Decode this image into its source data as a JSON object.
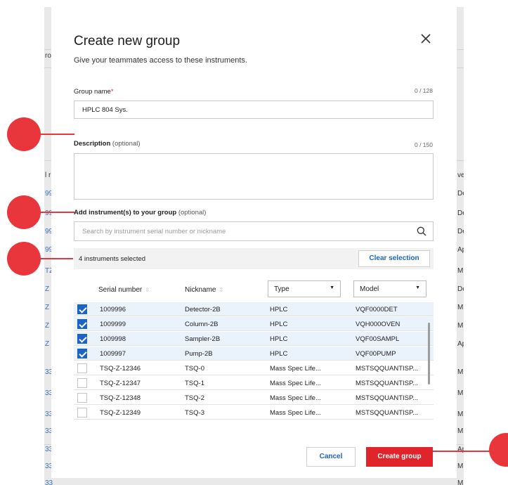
{
  "background": {
    "left_fragments": [
      "ro",
      "l r",
      "99",
      "99",
      "99",
      "99",
      "TZ",
      "Z",
      "Z",
      "Z",
      "Z",
      "33",
      "33",
      "33",
      "33",
      "33",
      "33",
      "33"
    ],
    "right_fragments": [
      "ve",
      "De",
      "De",
      "De",
      "Ap",
      "M",
      "De",
      "M",
      "M",
      "Ap",
      "M",
      "M",
      "M",
      "M",
      "Ap",
      "M",
      "M"
    ]
  },
  "modal": {
    "title": "Create new group",
    "subtitle": "Give your teammates access to these instruments.",
    "close_icon": "close-icon",
    "group_name": {
      "label": "Group name",
      "required_mark": "*",
      "counter": "0 / 128",
      "value": "HPLC 804 Sys."
    },
    "description": {
      "label": "Description",
      "optional": "(optional)",
      "counter": "0 / 150",
      "value": ""
    },
    "instruments": {
      "label": "Add instrument(s) to your group",
      "optional": "(optional)",
      "search_placeholder": "Search by instrument serial number or nickname",
      "search_icon": "search-icon"
    },
    "selection": {
      "text": "4 instruments selected",
      "clear_label": "Clear selection"
    },
    "table": {
      "headers": {
        "serial": "Serial number",
        "nickname": "Nickname",
        "type": "Type",
        "model": "Model"
      },
      "rows": [
        {
          "checked": true,
          "serial": "1009996",
          "nickname": "Detector-2B",
          "type": "HPLC",
          "model": "VQF0000DET"
        },
        {
          "checked": true,
          "serial": "1009999",
          "nickname": "Column-2B",
          "type": "HPLC",
          "model": "VQH000OVEN"
        },
        {
          "checked": true,
          "serial": "1009998",
          "nickname": "Sampler-2B",
          "type": "HPLC",
          "model": "VQF00SAMPL"
        },
        {
          "checked": true,
          "serial": "1009997",
          "nickname": "Pump-2B",
          "type": "HPLC",
          "model": "VQF00PUMP"
        },
        {
          "checked": false,
          "serial": "TSQ-Z-12346",
          "nickname": "TSQ-0",
          "type": "Mass Spec Life...",
          "model": "MSTSQQUANTISP..."
        },
        {
          "checked": false,
          "serial": "TSQ-Z-12347",
          "nickname": "TSQ-1",
          "type": "Mass Spec Life...",
          "model": "MSTSQQUANTISP..."
        },
        {
          "checked": false,
          "serial": "TSQ-Z-12348",
          "nickname": "TSQ-2",
          "type": "Mass Spec Life...",
          "model": "MSTSQQUANTISP..."
        },
        {
          "checked": false,
          "serial": "TSQ-Z-12349",
          "nickname": "TSQ-3",
          "type": "Mass Spec Life...",
          "model": "MSTSQQUANTISP..."
        }
      ]
    },
    "buttons": {
      "cancel": "Cancel",
      "create": "Create group"
    }
  },
  "colors": {
    "accent_red": "#e0242b",
    "link_blue": "#1d63c6",
    "callout_red": "#e9363d"
  }
}
